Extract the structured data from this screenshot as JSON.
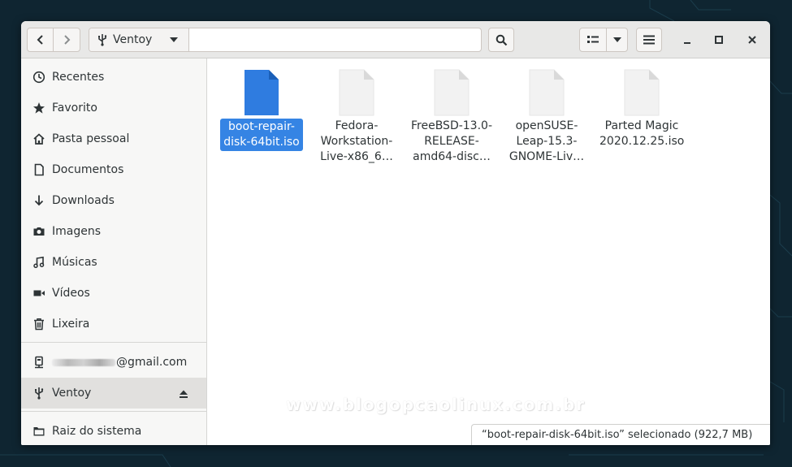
{
  "window": {
    "location": "Ventoy"
  },
  "sidebar": {
    "items": [
      {
        "label": "Recentes",
        "icon": "clock-icon"
      },
      {
        "label": "Favorito",
        "icon": "star-icon"
      },
      {
        "label": "Pasta pessoal",
        "icon": "home-icon"
      },
      {
        "label": "Documentos",
        "icon": "document-icon"
      },
      {
        "label": "Downloads",
        "icon": "download-arrow-icon"
      },
      {
        "label": "Imagens",
        "icon": "camera-icon"
      },
      {
        "label": "Músicas",
        "icon": "music-note-icon"
      },
      {
        "label": "Vídeos",
        "icon": "video-icon"
      },
      {
        "label": "Lixeira",
        "icon": "trash-icon"
      }
    ],
    "account": {
      "label": "@gmail.com",
      "icon": "network-account-icon"
    },
    "device": {
      "label": "Ventoy",
      "icon": "usb-icon"
    },
    "root": {
      "label": "Raiz do sistema",
      "icon": "drive-icon"
    }
  },
  "files": [
    {
      "name": "boot-repair-disk-64bit.iso",
      "line1": "boot-repair-",
      "line2": "disk-64bit.iso",
      "line3": "",
      "selected": true
    },
    {
      "name": "Fedora-Workstation-Live-x86_6…",
      "line1": "Fedora-",
      "line2": "Workstation-",
      "line3": "Live-x86_6…",
      "selected": false
    },
    {
      "name": "FreeBSD-13.0-RELEASE-amd64-disc…",
      "line1": "FreeBSD-13.0-",
      "line2": "RELEASE-",
      "line3": "amd64-disc…",
      "selected": false
    },
    {
      "name": "openSUSE-Leap-15.3-GNOME-Liv…",
      "line1": "openSUSE-",
      "line2": "Leap-15.3-",
      "line3": "GNOME-Liv…",
      "selected": false
    },
    {
      "name": "Parted Magic 2020.12.25.iso",
      "line1": "Parted Magic",
      "line2": "2020.12.25.iso",
      "line3": "",
      "selected": false
    }
  ],
  "status": {
    "text": "“boot-repair-disk-64bit.iso” selecionado  (922,7 MB)"
  },
  "watermark": "www.blogopcaolinux.com.br",
  "colors": {
    "accent": "#3584e4",
    "selected_file_icon": "#2f7ce0",
    "generic_file_icon": "#f2f2f2"
  }
}
